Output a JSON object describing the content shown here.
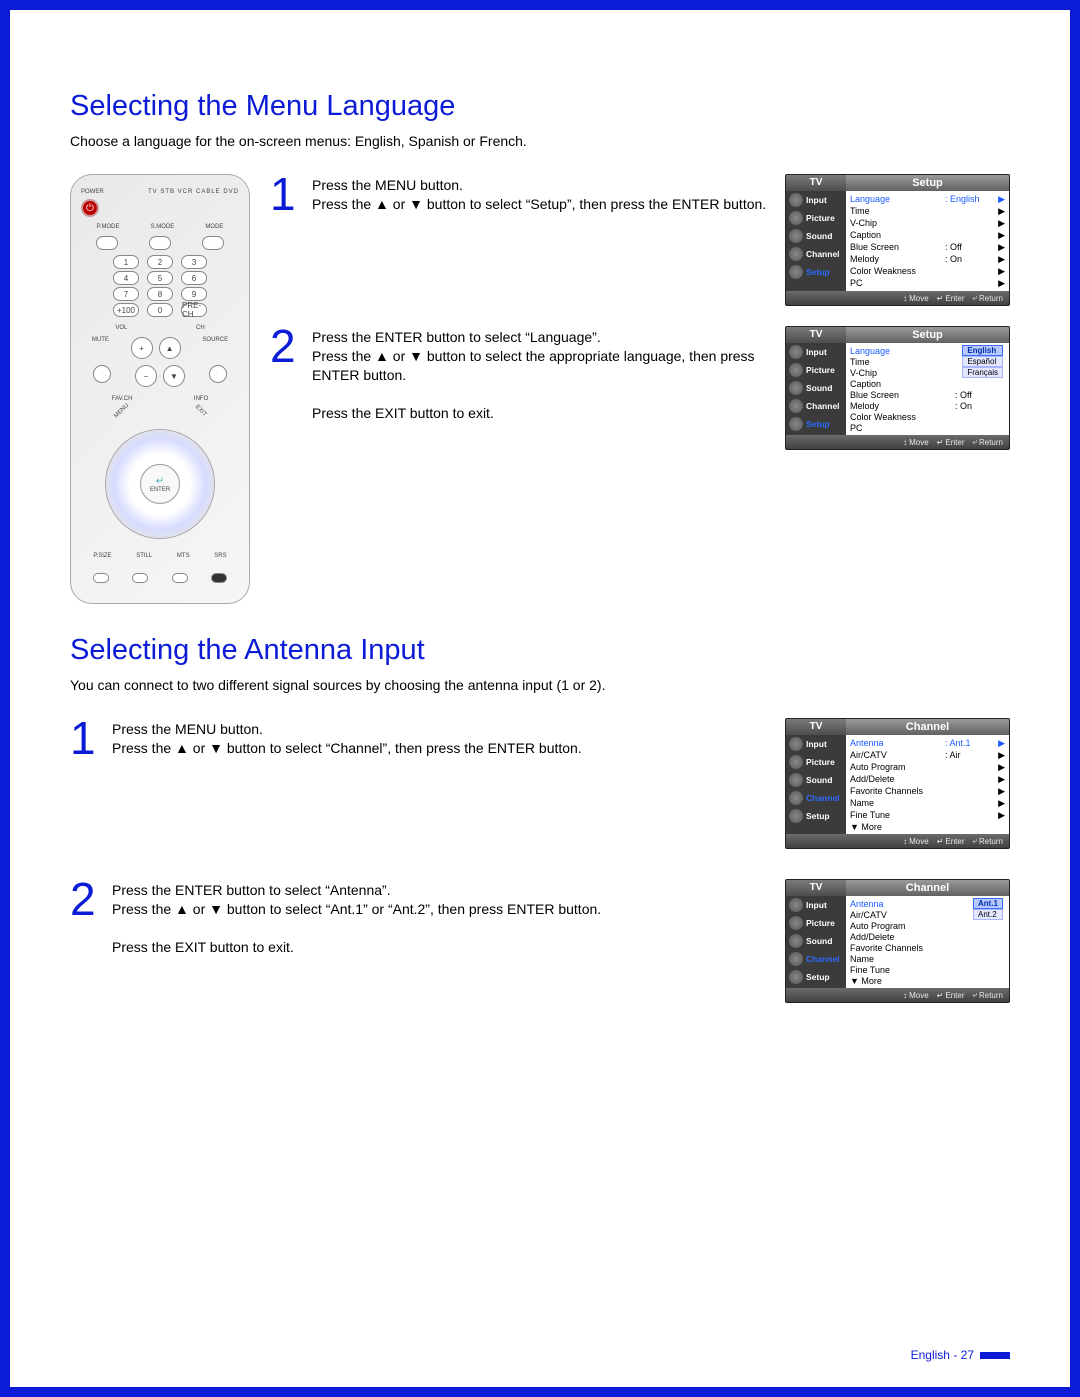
{
  "section1": {
    "title": "Selecting the Menu Language",
    "intro": "Choose a language for the on-screen menus: English, Spanish or French.",
    "step1": {
      "num": "1",
      "line1": "Press the MENU button.",
      "line2a": "Press the ",
      "line2b": " or ",
      "line2c": " button to select “Setup”, then press the ENTER button."
    },
    "step2": {
      "num": "2",
      "line1": "Press the ENTER button to select “Language”.",
      "line2a": "Press the ",
      "line2b": " or ",
      "line2c": " button to select the appropriate language, then press ENTER button.",
      "line3": "Press the EXIT button to exit."
    }
  },
  "osd_labels": {
    "tv": "TV",
    "setup": "Setup",
    "channel": "Channel",
    "side": {
      "input": "Input",
      "picture": "Picture",
      "sound": "Sound",
      "channel": "Channel",
      "setup": "Setup"
    },
    "foot": {
      "move": "Move",
      "enter": "Enter",
      "return": "Return",
      "updown": "↕",
      "enter_icon": "↵",
      "return_icon": "⤶"
    }
  },
  "osd1": {
    "rows": [
      {
        "k": "Language",
        "v": ": English",
        "hi": true,
        "caret": "▶"
      },
      {
        "k": "Time",
        "v": "",
        "caret": "▶"
      },
      {
        "k": "V-Chip",
        "v": "",
        "caret": "▶"
      },
      {
        "k": "Caption",
        "v": "",
        "caret": "▶"
      },
      {
        "k": "Blue Screen",
        "v": ": Off",
        "caret": "▶"
      },
      {
        "k": "Melody",
        "v": ": On",
        "caret": "▶"
      },
      {
        "k": "Color Weakness",
        "v": "",
        "caret": "▶"
      },
      {
        "k": "PC",
        "v": "",
        "caret": "▶"
      }
    ]
  },
  "osd2": {
    "rows": [
      {
        "k": "Language",
        "hi": true
      },
      {
        "k": "Time"
      },
      {
        "k": "V-Chip"
      },
      {
        "k": "Caption"
      },
      {
        "k": "Blue Screen",
        "v": ": Off"
      },
      {
        "k": "Melody",
        "v": ": On"
      },
      {
        "k": "Color Weakness"
      },
      {
        "k": "PC"
      }
    ],
    "options": [
      "English",
      "Español",
      "Français"
    ]
  },
  "section2": {
    "title": "Selecting the Antenna Input",
    "intro": "You can connect to two different signal sources by choosing the antenna input (1 or 2).",
    "step1": {
      "num": "1",
      "line1": "Press the MENU button.",
      "line2a": "Press the ",
      "line2b": " or ",
      "line2c": " button to select “Channel”, then press the ENTER button."
    },
    "step2": {
      "num": "2",
      "line1": "Press the ENTER button to select “Antenna”.",
      "line2a": "Press the ",
      "line2b": " or ",
      "line2c": " button to select “Ant.1” or “Ant.2”, then press ENTER button.",
      "line3": "Press the EXIT button to exit."
    }
  },
  "osd3": {
    "rows": [
      {
        "k": "Antenna",
        "v": ": Ant.1",
        "hi": true,
        "caret": "▶"
      },
      {
        "k": "Air/CATV",
        "v": ": Air",
        "caret": "▶"
      },
      {
        "k": "Auto Program",
        "caret": "▶"
      },
      {
        "k": "Add/Delete",
        "caret": "▶"
      },
      {
        "k": "Favorite Channels",
        "caret": "▶"
      },
      {
        "k": "Name",
        "caret": "▶"
      },
      {
        "k": "Fine Tune",
        "caret": "▶"
      },
      {
        "k": "▼ More"
      }
    ]
  },
  "osd4": {
    "rows": [
      {
        "k": "Antenna",
        "hi": true
      },
      {
        "k": "Air/CATV"
      },
      {
        "k": "Auto Program"
      },
      {
        "k": "Add/Delete"
      },
      {
        "k": "Favorite Channels"
      },
      {
        "k": "Name"
      },
      {
        "k": "Fine Tune"
      },
      {
        "k": "▼ More"
      }
    ],
    "options": [
      "Ant.1",
      "Ant.2"
    ]
  },
  "remote": {
    "power": "⏻",
    "top_labels": "TV  STB  VCR  CABLE  DVD",
    "pmode": "P.MODE",
    "smode": "S.MODE",
    "mode": "MODE",
    "nums": [
      [
        "1",
        "2",
        "3"
      ],
      [
        "4",
        "5",
        "6"
      ],
      [
        "7",
        "8",
        "9"
      ],
      [
        "+100",
        "0",
        "PRE-CH"
      ]
    ],
    "vol": "VOL",
    "ch": "CH",
    "mute": "MUTE",
    "source": "SOURCE",
    "favch": "FAV.CH",
    "info": "INFO",
    "menu": "MENU",
    "exit": "EXIT",
    "enter_icon": "↵",
    "enter_text": "ENTER",
    "bottom": [
      "P.SIZE",
      "STILL",
      "MTS",
      "SRS"
    ]
  },
  "footer": "English - 27"
}
